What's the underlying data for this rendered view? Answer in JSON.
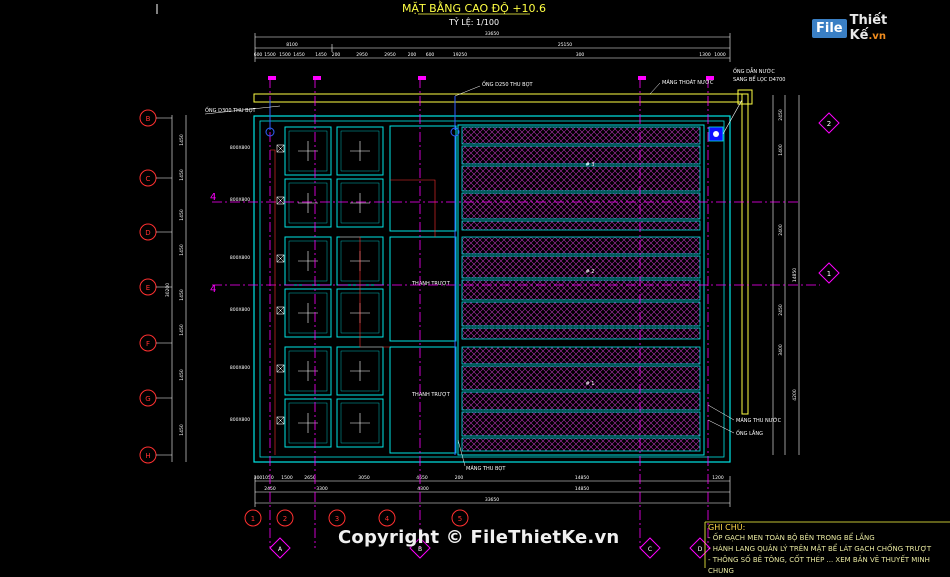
{
  "drawing": {
    "title": "MẶT BẰNG CAO ĐỘ +10.6",
    "scale": "TỶ LỆ: 1/100",
    "top_dims": [
      "33650",
      "8100",
      "25150",
      "600",
      "1500",
      "1500",
      "1450",
      "1450",
      "200",
      "2950",
      "2950",
      "200",
      "600",
      "19250",
      "300",
      "1300",
      "1000"
    ],
    "bottom_dims": [
      "300",
      "1050",
      "1500",
      "2650",
      "3050",
      "4650",
      "200",
      "14850",
      "1200",
      "2450",
      "3300",
      "4300",
      "14850",
      "33650"
    ],
    "left_dims": [
      "1450",
      "1450",
      "1450",
      "1450",
      "1450",
      "1450",
      "1450",
      "1450",
      "30200"
    ],
    "right_dims": [
      "2450",
      "1400",
      "2400",
      "2450",
      "3400",
      "4200",
      "14850"
    ],
    "valve_labels": [
      "800X800",
      "800X800",
      "800X800",
      "800X800",
      "800X800",
      "800X800"
    ],
    "room_labels": {
      "r1": "THANH TRƯỢT",
      "r2": "THANH TRƯỢT"
    },
    "tank_labels": [
      "# 3",
      "# 2",
      "# 1"
    ],
    "callouts": {
      "pipe_top": "ỐNG D250 THU BỌT",
      "pipe_left": "ỐNG D300 THU BỌT",
      "gutter": "MÁNG THU BỌT",
      "launder_top": "MÁNG THOÁT NƯỚC",
      "pipe_in": "ỐNG DẪN NƯỚC",
      "pipe_in2": "SANG BỂ LỌC D4700",
      "drain1": "MÁNG THU NƯỚC",
      "drain2": "ỐNG LẮNG"
    },
    "grid_rows": [
      "B",
      "C",
      "D",
      "E",
      "F",
      "G",
      "H",
      "I"
    ],
    "grid_cols": [
      "1",
      "2",
      "3",
      "4",
      "5"
    ],
    "side_markers": [
      "2",
      "1"
    ],
    "section_marks": [
      "A",
      "B",
      "C",
      "D"
    ],
    "section_row_labels": [
      "4",
      "4"
    ],
    "notes_header": "GHI CHÚ:",
    "notes": [
      "- ỐP GẠCH MEN TOÀN BỘ BÊN TRONG BỂ LẮNG",
      "- HÀNH LANG QUẢN LÝ TRÊN MẶT BỂ LÁT GẠCH CHỐNG TRƯỢT",
      "- THÔNG SỐ BÊ TÔNG, CỐT THÉP ... XEM BẢN VẼ THUYẾT MINH CHUNG"
    ]
  },
  "logo": {
    "box": "File",
    "rest": "Thiết Kế",
    "dom": ".vn"
  },
  "copyright": "Copyright © FileThietKe.vn",
  "colors": {
    "bg": "#000000",
    "cyan": "#00e5e5",
    "white": "#ffffff",
    "magenta": "#ff00ff",
    "yellow": "#ffff44",
    "red": "#ff3030",
    "hatch": "#cc33cc",
    "green": "#40ff40"
  }
}
